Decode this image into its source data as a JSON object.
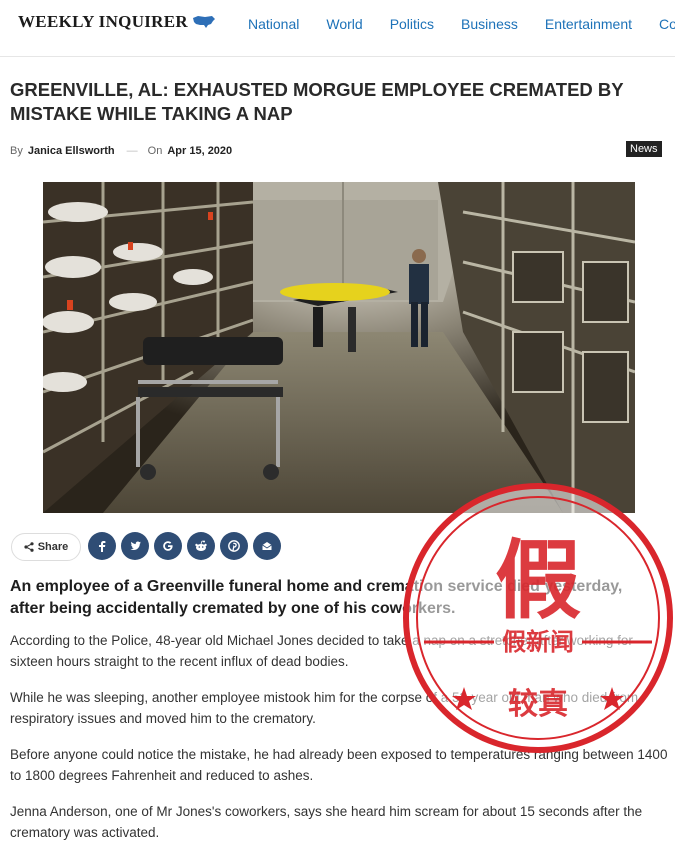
{
  "header": {
    "logo_text": "WEEKLY INQUIRER",
    "nav": [
      "National",
      "World",
      "Politics",
      "Business",
      "Entertainment",
      "Co"
    ]
  },
  "article": {
    "title": "GREENVILLE, AL: EXHAUSTED MORGUE EMPLOYEE CREMATED BY MISTAKE WHILE TAKING A NAP",
    "meta": {
      "by_label": "By",
      "author": "Janica Ellsworth",
      "on_label": "On",
      "date": "Apr 15, 2020"
    },
    "category": "News",
    "share_label": "Share",
    "social_icons": [
      "facebook-icon",
      "twitter-icon",
      "google-icon",
      "reddit-icon",
      "pinterest-icon",
      "email-icon"
    ],
    "lead": "An employee of a Greenville funeral home and cremation service died yesterday, after being accidentally cremated by one of his coworkers.",
    "paragraphs": [
      "According to the Police, 48-year old Michael Jones decided to take a nap on a stretcher after working for sixteen hours straight to the recent influx of dead bodies.",
      "While he was sleeping, another employee mistook him for the corpse of a 52-year old man who died from respiratory issues and moved him to the crematory.",
      "Before anyone could notice the mistake, he had already been exposed to temperatures ranging between 1400 to 1800 degrees Fahrenheit and reduced to ashes.",
      "Jenna Anderson, one of Mr Jones's coworkers, says she heard him scream for about 15 seconds after the crematory was activated."
    ]
  },
  "stamp": {
    "big_char": "假",
    "middle_text": "假新闻",
    "bottom_text": "较真"
  },
  "colors": {
    "nav": "#1d72b8",
    "social": "#2f4d75",
    "stamp": "#d9262c"
  }
}
